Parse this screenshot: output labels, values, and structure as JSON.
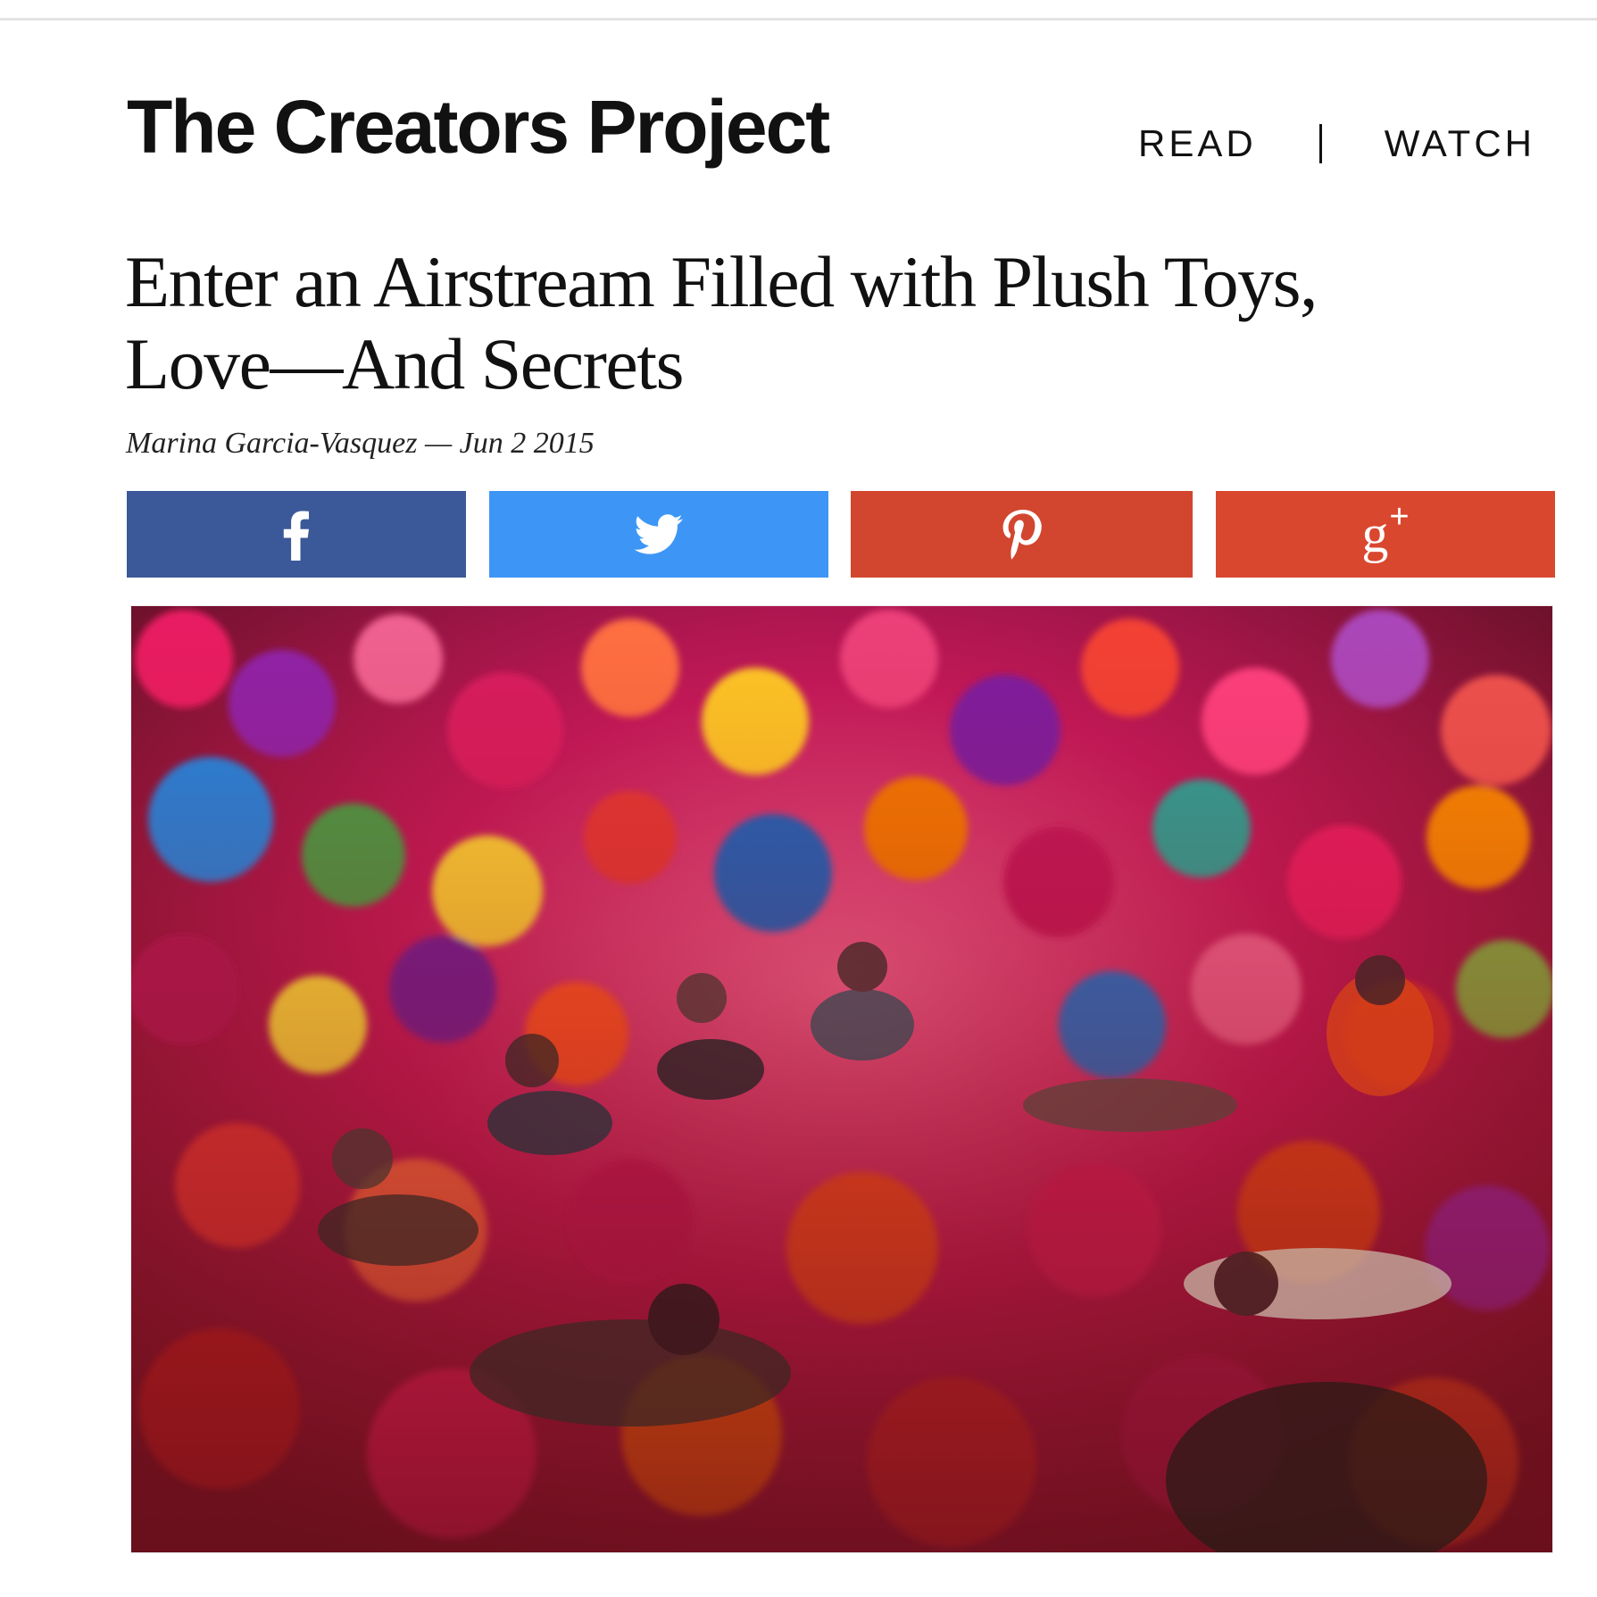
{
  "site": {
    "logo_text": "The Creators Project"
  },
  "nav": {
    "items": [
      "READ",
      "WATCH"
    ]
  },
  "article": {
    "headline_line1": "Enter an Airstream Filled with Plush Toys,",
    "headline_line2": "Love—And Secrets",
    "author": "Marina Garcia-Vasquez",
    "byline_separator": "—",
    "date": "Jun 2 2015"
  },
  "share_buttons": [
    {
      "network": "facebook",
      "icon": "facebook-icon",
      "color": "#3b5998"
    },
    {
      "network": "twitter",
      "icon": "twitter-icon",
      "color": "#3d96f5"
    },
    {
      "network": "pinterest",
      "icon": "pinterest-icon",
      "color": "#d2452f"
    },
    {
      "network": "google-plus",
      "icon": "google-plus-icon",
      "label": "g",
      "label_sup": "+",
      "color": "#d9472f"
    }
  ],
  "hero_image": {
    "description_colors": [
      "#e8175d",
      "#c0392b",
      "#f39c12",
      "#8e44ad",
      "#2e86de",
      "#27ae60"
    ]
  }
}
